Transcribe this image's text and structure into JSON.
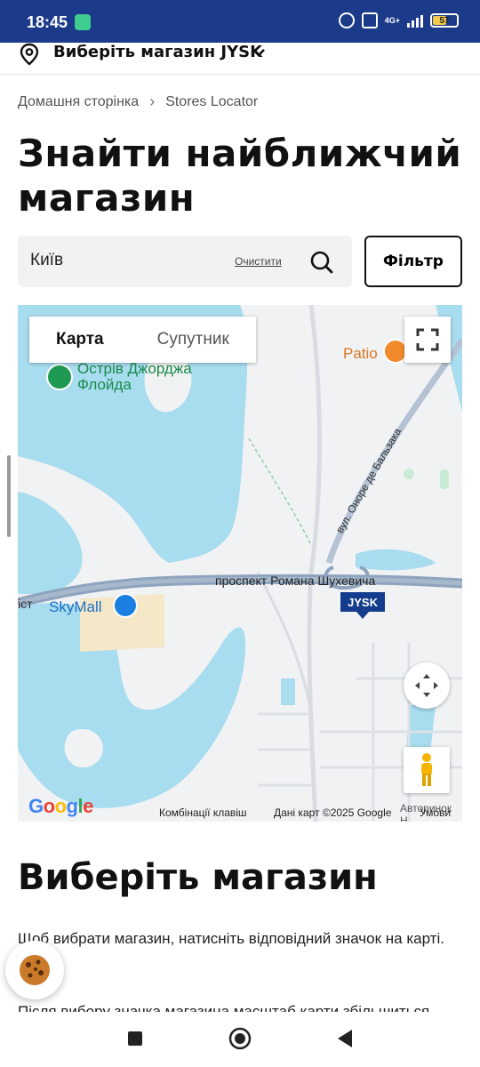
{
  "status_bar": {
    "time": "18:45",
    "network": "4G+",
    "battery_level": "57",
    "battery_fraction": 0.57
  },
  "store_selector": {
    "label": "Виберіть магазин JYSK",
    "icon": "location-pin-icon"
  },
  "breadcrumb": {
    "items": [
      "Домашня сторінка",
      "Stores Locator"
    ],
    "separator": "›"
  },
  "page_title": "Знайти найближчий магазин",
  "search": {
    "value": "Київ",
    "clear_label": "Очистити",
    "filter_label": "Фільтр"
  },
  "map": {
    "tabs": [
      "Карта",
      "Супутник"
    ],
    "active_tab": "Карта",
    "labels": {
      "island": "Острів Джорджа\nФлойда",
      "mall": "SkyMall",
      "restaurant": "Patio",
      "avenue": "проспект Романа Шухевича",
      "street": "вул. Оноре де Бальзака",
      "store_marker": "JYSK",
      "edge_left": "іст",
      "edge_bottom": "Авторинок Н"
    },
    "footer": {
      "shortcuts": "Комбінації клавіш",
      "map_data": "Дані карт ©2025 Google",
      "terms": "Умови"
    },
    "logo": "Google",
    "colors": {
      "water": "#a8dcef",
      "land": "#f2f3f5",
      "road": "#8ea3bd",
      "park": "#c8ebd6"
    }
  },
  "section": {
    "title": "Виберіть магазин",
    "paragraph1": "Щоб вибрати магазин, натисніть відповідний значок на карті.",
    "paragraph2": "Після вибору значка магазина масштаб карти збільшиться"
  },
  "colors": {
    "status_bar": "#1b3a8a",
    "text": "#111111",
    "search_bg": "#f2f2f2",
    "jysk_blue": "#143c8c"
  }
}
